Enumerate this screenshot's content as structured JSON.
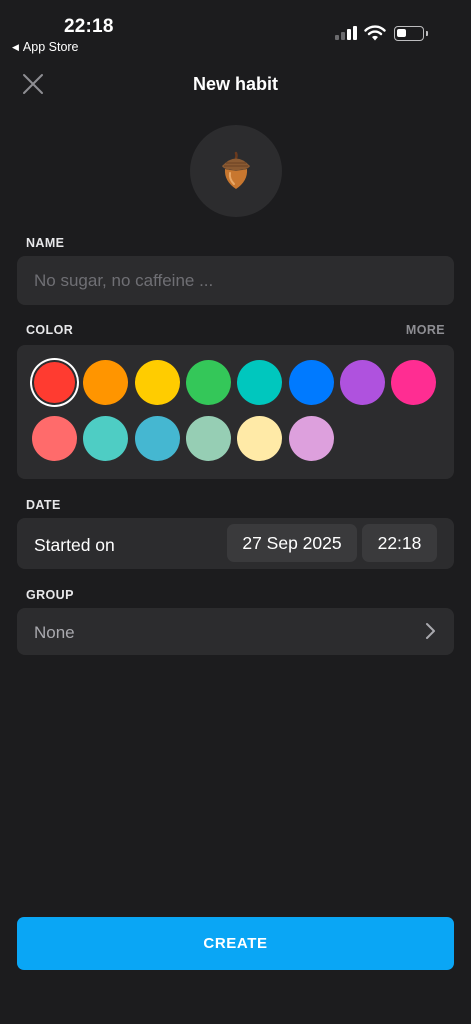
{
  "status_bar": {
    "time": "22:18",
    "back_app": "App Store",
    "back_arrow": "◀"
  },
  "header": {
    "title": "New habit",
    "close_icon": "close-icon"
  },
  "habit_icon": {
    "emoji": "🌰",
    "icon_name": "acorn-icon"
  },
  "name": {
    "label": "NAME",
    "placeholder": "No sugar, no caffeine ...",
    "value": ""
  },
  "color": {
    "label": "COLOR",
    "more_label": "MORE",
    "selected_index": 0,
    "swatches": [
      "#ff3b30",
      "#ff9500",
      "#ffcc00",
      "#34c759",
      "#00c7be",
      "#007aff",
      "#af52de",
      "#ff2d92",
      "#ff6b6b",
      "#4ecdc4",
      "#45b7d1",
      "#96ceb4",
      "#ffeaa7",
      "#dda0dd"
    ]
  },
  "date": {
    "label": "DATE",
    "started_label": "Started on",
    "date_value": "27 Sep 2025",
    "time_value": "22:18"
  },
  "group": {
    "label": "GROUP",
    "value": "None",
    "chevron_icon": "chevron-right-icon"
  },
  "create_button": {
    "label": "CREATE",
    "color": "#0aa6f5"
  }
}
